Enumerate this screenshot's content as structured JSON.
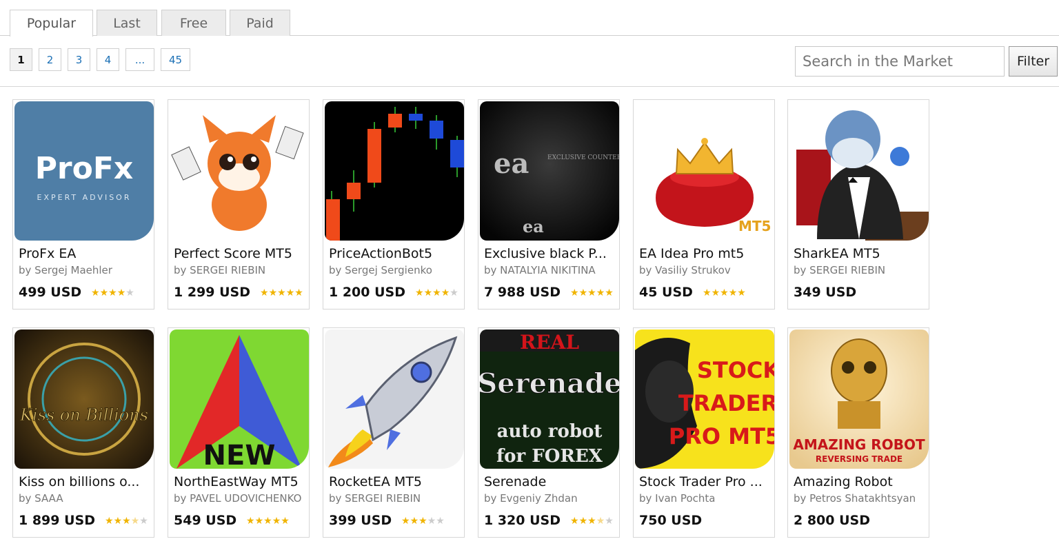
{
  "tabs": [
    "Popular",
    "Last",
    "Free",
    "Paid"
  ],
  "pagination": [
    "1",
    "2",
    "3",
    "4",
    "...",
    "45"
  ],
  "search": {
    "placeholder": "Search in the Market",
    "value": ""
  },
  "filter_label": "Filter",
  "products": [
    {
      "title": "ProFx EA",
      "author": "by Sergej Maehler",
      "price": "499 USD",
      "rating": 4,
      "thumb_text": "ProFx",
      "thumb_sub": "EXPERT ADVISOR"
    },
    {
      "title": "Perfect Score MT5",
      "author": "by SERGEI RIEBIN",
      "price": "1 299 USD",
      "rating": 5
    },
    {
      "title": "PriceActionBot5",
      "author": "by Sergej Sergienko",
      "price": "1 200 USD",
      "rating": 4
    },
    {
      "title": "Exclusive black P...",
      "author": "by NATALYIA NIKITINA",
      "price": "7 988 USD",
      "rating": 5,
      "thumb_text": "EXCLUSIVE COUNTERTOPS AUSTRALIA"
    },
    {
      "title": "EA Idea Pro mt5",
      "author": "by Vasiliy Strukov",
      "price": "45 USD",
      "rating": 5,
      "thumb_text": "MT5"
    },
    {
      "title": "SharkEA MT5",
      "author": "by SERGEI RIEBIN",
      "price": "349 USD",
      "rating": 0
    },
    {
      "title": "Kiss on billions o...",
      "author": "by SAAA",
      "price": "1 899 USD",
      "rating": 3.5,
      "thumb_text": "Kiss on Billions"
    },
    {
      "title": "NorthEastWay MT5",
      "author": "by PAVEL UDOVICHENKO",
      "price": "549 USD",
      "rating": 5,
      "thumb_text": "NEW"
    },
    {
      "title": "RocketEA MT5",
      "author": "by SERGEI RIEBIN",
      "price": "399 USD",
      "rating": 3
    },
    {
      "title": "Serenade",
      "author": "by Evgeniy Zhdan",
      "price": "1 320 USD",
      "rating": 3.5,
      "thumb_text": "REAL",
      "thumb_text2": "Serenade",
      "thumb_text3": "auto robot",
      "thumb_text4": "for FOREX"
    },
    {
      "title": "Stock Trader Pro ...",
      "author": "by Ivan Pochta",
      "price": "750 USD",
      "rating": 0,
      "thumb_text": "STOCK",
      "thumb_text2": "TRADER",
      "thumb_text3": "PRO MT5"
    },
    {
      "title": "Amazing Robot",
      "author": "by Petros Shatakhtsyan",
      "price": "2 800 USD",
      "rating": 0,
      "thumb_text": "AMAZING ROBOT",
      "thumb_text2": "REVERSING TRADE"
    }
  ],
  "colors": {
    "link": "#1a6fb5",
    "star": "#f0b400"
  }
}
